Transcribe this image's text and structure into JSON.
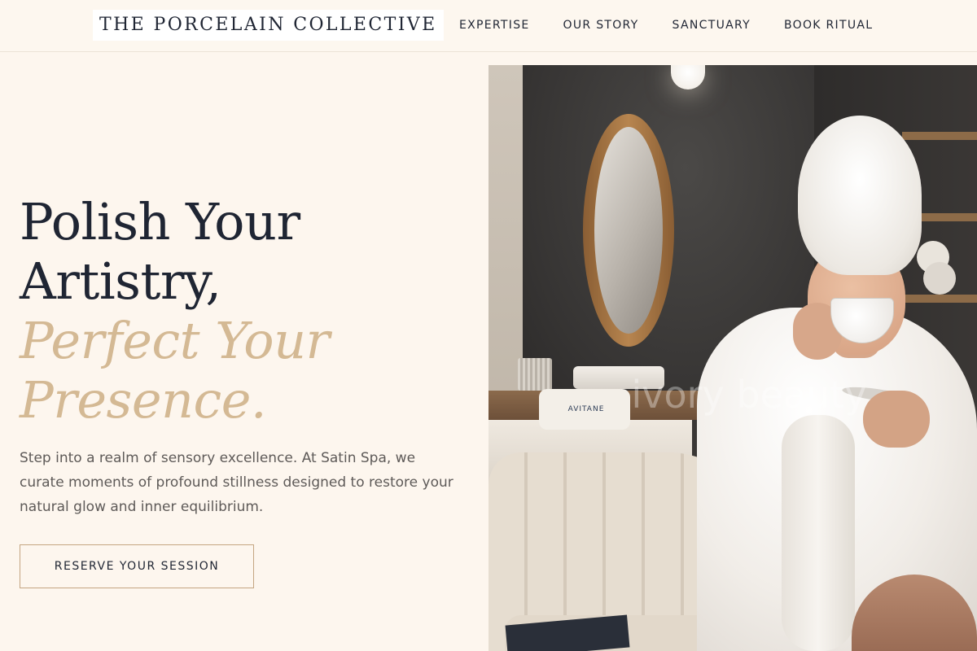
{
  "header": {
    "brand": "THE PORCELAIN COLLECTIVE",
    "nav": [
      {
        "label": "EXPERTISE"
      },
      {
        "label": "OUR STORY"
      },
      {
        "label": "SANCTUARY"
      },
      {
        "label": "BOOK RITUAL"
      }
    ]
  },
  "hero": {
    "title_lines": [
      "Polish Your",
      "Artistry,"
    ],
    "accent_lines": [
      "Perfect Your",
      "Presence."
    ],
    "description": "Step into a realm of sensory excellence. At Satin Spa, we curate moments of profound stillness designed to restore your natural glow and inner equilibrium.",
    "cta_label": "RESERVE YOUR SESSION"
  },
  "image": {
    "watermark": "ivory beauty",
    "product_label": "AVITANE"
  },
  "colors": {
    "background": "#fdf6ee",
    "heading": "#1f2533",
    "accent": "#d4b994",
    "body_text": "#5e5a58",
    "cta_border": "#c4a581"
  }
}
